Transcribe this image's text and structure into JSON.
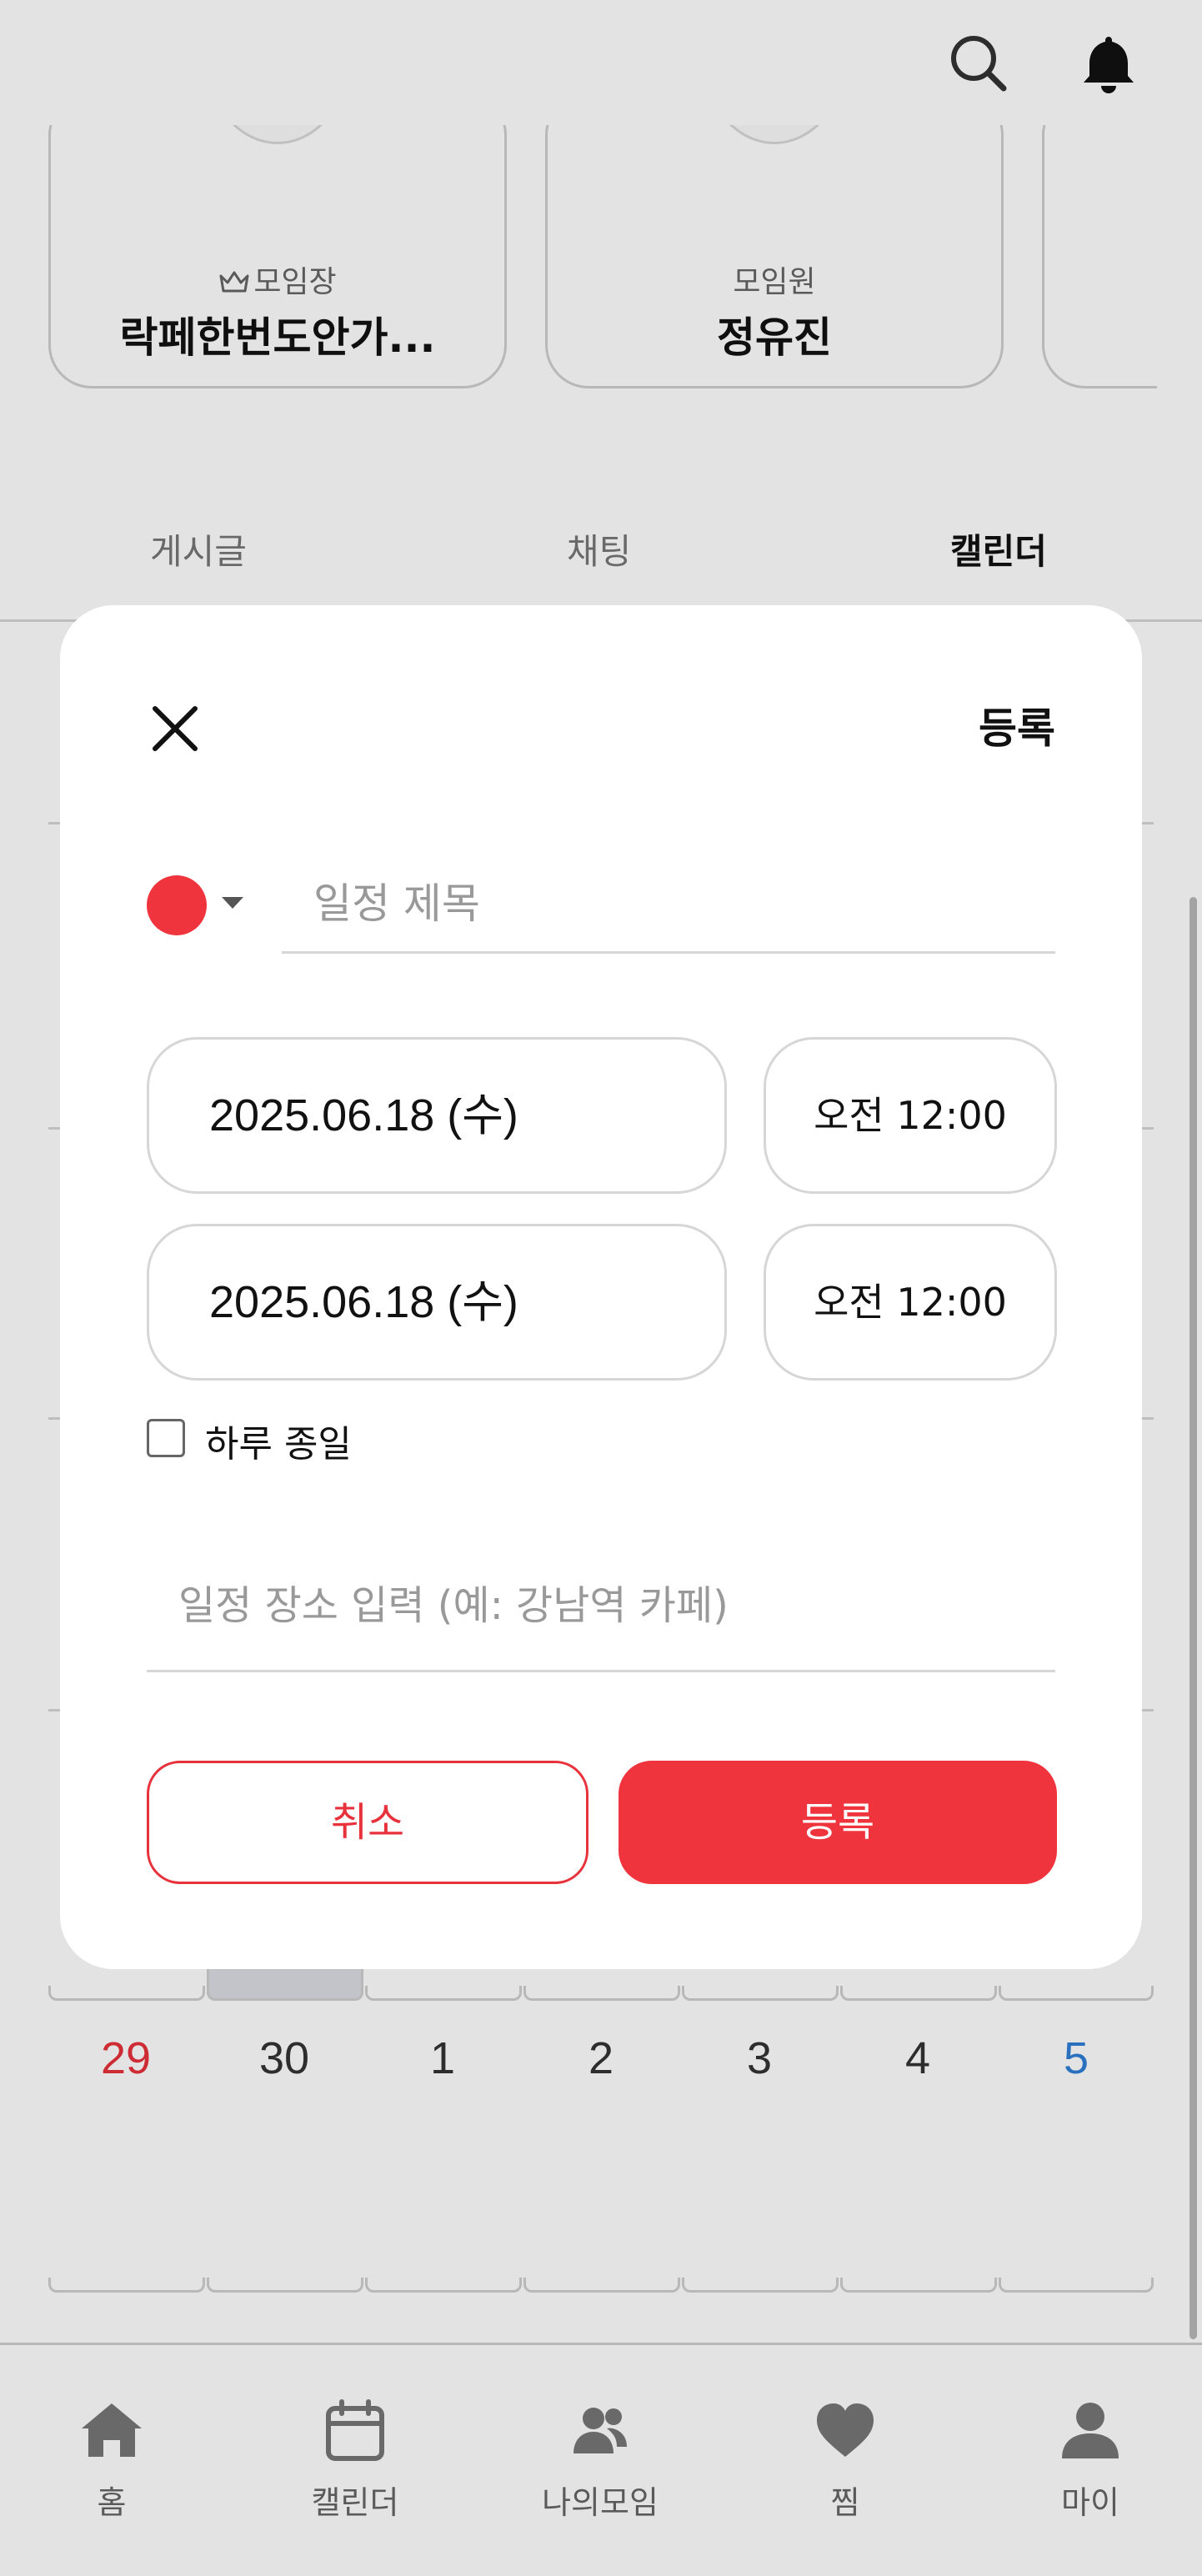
{
  "header": {
    "icons": [
      "search-icon",
      "bell-icon"
    ]
  },
  "members": [
    {
      "role": "모임장",
      "name": "락페한번도안가...",
      "role_icon": "crown-icon"
    },
    {
      "role": "모임원",
      "name": "정유진"
    }
  ],
  "tabs": [
    {
      "label": "게시글",
      "active": false
    },
    {
      "label": "채팅",
      "active": false
    },
    {
      "label": "캘린더",
      "active": true
    }
  ],
  "calendar_visible_week": {
    "dates": [
      "29",
      "30",
      "1",
      "2",
      "3",
      "4",
      "5"
    ],
    "sunday_color": "#e8323b",
    "saturday_color": "#2f7fd6"
  },
  "modal": {
    "close_icon": "close-icon",
    "register_label": "등록",
    "color": "#ef343d",
    "title_placeholder": "일정 제목",
    "start_date": "2025.06.18 (수)",
    "start_time": "오전 12:00",
    "end_date": "2025.06.18 (수)",
    "end_time": "오전 12:00",
    "allday_label": "하루 종일",
    "allday_checked": false,
    "place_placeholder": "일정 장소 입력 (예: 강남역 카페)",
    "cancel_label": "취소",
    "submit_label": "등록"
  },
  "bottom_nav": [
    {
      "label": "홈",
      "icon": "home-icon"
    },
    {
      "label": "캘린더",
      "icon": "calendar-icon"
    },
    {
      "label": "나의모임",
      "icon": "group-icon"
    },
    {
      "label": "찜",
      "icon": "heart-icon"
    },
    {
      "label": "마이",
      "icon": "person-icon"
    }
  ],
  "colors": {
    "accent": "#ef343d",
    "border": "#d6d6d6",
    "text_muted": "#999999"
  }
}
